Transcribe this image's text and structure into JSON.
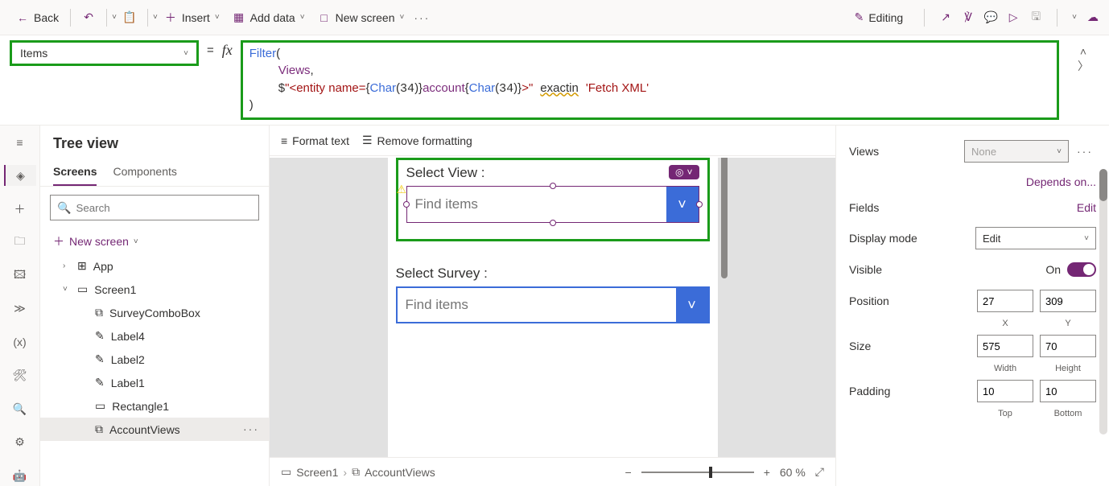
{
  "toolbar": {
    "back": "Back",
    "insert": "Insert",
    "add_data": "Add data",
    "new_screen": "New screen",
    "editing": "Editing"
  },
  "formula": {
    "property": "Items"
  },
  "tree": {
    "title": "Tree view",
    "tab_screens": "Screens",
    "tab_components": "Components",
    "search_placeholder": "Search",
    "new_screen": "New screen",
    "items": {
      "app": "App",
      "screen1": "Screen1",
      "surveycombo": "SurveyComboBox",
      "label4": "Label4",
      "label2": "Label2",
      "label1": "Label1",
      "rect1": "Rectangle1",
      "accountviews": "AccountViews"
    }
  },
  "fmt": {
    "format_text": "Format text",
    "remove_formatting": "Remove formatting"
  },
  "canvas": {
    "select_view_label": "Select View :",
    "find_items": "Find items",
    "select_survey_label": "Select Survey :",
    "find_items2": "Find items"
  },
  "footer": {
    "screen": "Screen1",
    "control": "AccountViews",
    "zoom": "60  %"
  },
  "props": {
    "views_label": "Views",
    "views_value": "None",
    "depends_on": "Depends on...",
    "fields_label": "Fields",
    "edit_link": "Edit",
    "display_mode_label": "Display mode",
    "display_mode_value": "Edit",
    "visible_label": "Visible",
    "visible_on": "On",
    "position_label": "Position",
    "pos_x": "27",
    "pos_y": "309",
    "sub_x": "X",
    "sub_y": "Y",
    "size_label": "Size",
    "size_w": "575",
    "size_h": "70",
    "sub_w": "Width",
    "sub_h": "Height",
    "padding_label": "Padding",
    "pad_t": "10",
    "pad_b": "10",
    "sub_top": "Top",
    "sub_bottom": "Bottom"
  }
}
